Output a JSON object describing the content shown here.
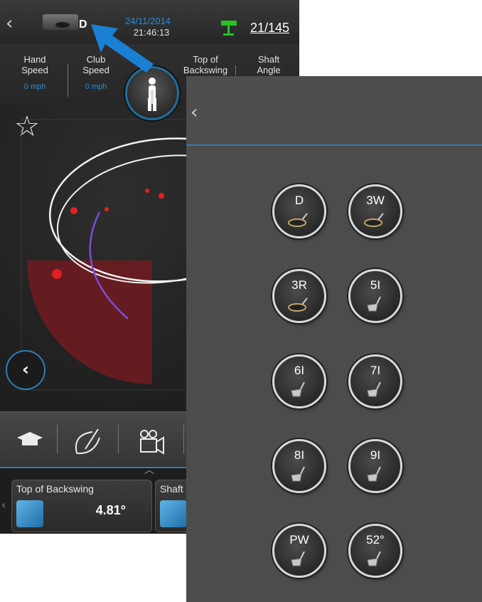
{
  "status": {
    "club": "D",
    "date": "24/11/2014",
    "time": "21:46:13",
    "shot_counter": "21/145",
    "colors": {
      "accent": "#1e8ee0",
      "flag": "#23c423",
      "arrow": "#1a80d4",
      "path_red": "#7a1f22"
    }
  },
  "metrics": [
    {
      "label": "Hand\nSpeed",
      "value": "0 mph"
    },
    {
      "label": "Club\nSpeed",
      "value": "0 mph"
    },
    {
      "label": "Top of\nBackswing",
      "value": ""
    },
    {
      "label": "Shaft\nAngle",
      "value": ""
    }
  ],
  "icons": {
    "back": "‹",
    "star": "☆",
    "left_nav": "‹",
    "up_caret": "︿"
  },
  "toolbar": {
    "items": [
      "graduation-cap-icon",
      "swing-path-icon",
      "video-camera-icon"
    ]
  },
  "bottom_cards": [
    {
      "title": "Top of Backswing",
      "value": "4.81°"
    },
    {
      "title": "Shaft",
      "value": ""
    }
  ],
  "club_select": {
    "clubs": [
      "D",
      "3W",
      "3R",
      "5I",
      "6I",
      "7I",
      "8I",
      "9I",
      "PW",
      "52°"
    ]
  }
}
